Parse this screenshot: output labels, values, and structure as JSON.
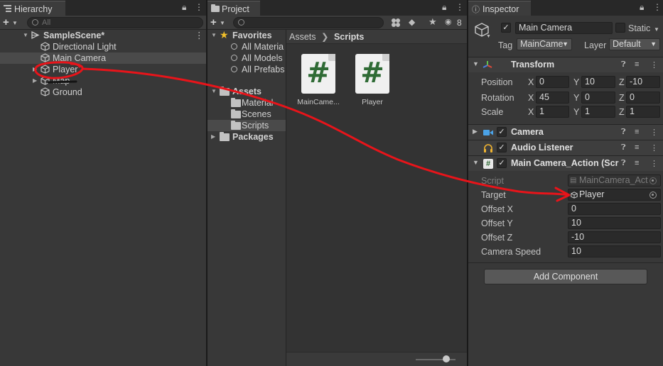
{
  "hierarchy": {
    "tab": "Hierarchy",
    "search_placeholder": "All",
    "scene": "SampleScene*",
    "items": [
      "Directional Light",
      "Main Camera",
      "Player",
      "Map",
      "Ground"
    ]
  },
  "project": {
    "tab": "Project",
    "hidden_count": "8",
    "favorites_label": "Favorites",
    "favorites": [
      "All Materia",
      "All Models",
      "All Prefabs"
    ],
    "assets_label": "Assets",
    "folders": [
      "Material",
      "Scenes",
      "Scripts"
    ],
    "packages_label": "Packages",
    "breadcrumb": {
      "root": "Assets",
      "current": "Scripts"
    },
    "files": [
      {
        "name": "MainCame...",
        "glyph": "#"
      },
      {
        "name": "Player",
        "glyph": "#"
      }
    ]
  },
  "inspector": {
    "tab": "Inspector",
    "object_name": "Main Camera",
    "static_label": "Static",
    "tag_label": "Tag",
    "tag_value": "MainCame",
    "layer_label": "Layer",
    "layer_value": "Default",
    "transform": {
      "title": "Transform",
      "position_label": "Position",
      "rotation_label": "Rotation",
      "scale_label": "Scale",
      "axes": [
        "X",
        "Y",
        "Z"
      ],
      "position": [
        "0",
        "10",
        "-10"
      ],
      "rotation": [
        "45",
        "0",
        "0"
      ],
      "scale": [
        "1",
        "1",
        "1"
      ]
    },
    "camera_title": "Camera",
    "audio_title": "Audio Listener",
    "script_comp": {
      "title": "Main Camera_Action (Scr",
      "script_label": "Script",
      "script_value": "MainCamera_Act",
      "target_label": "Target",
      "target_value": "Player",
      "offset_x_label": "Offset X",
      "offset_x": "0",
      "offset_y_label": "Offset Y",
      "offset_y": "10",
      "offset_z_label": "Offset Z",
      "offset_z": "-10",
      "speed_label": "Camera Speed",
      "speed": "10"
    },
    "add_component": "Add Component"
  },
  "colors": {
    "annotation": "#e8141a",
    "script_green": "#2f6b35",
    "favorites_star": "#f2c029"
  }
}
